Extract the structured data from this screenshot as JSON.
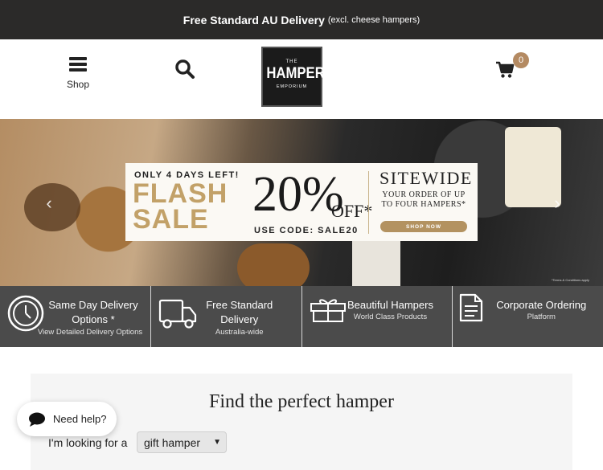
{
  "topbar": {
    "main": "Free Standard AU Delivery",
    "note": "(excl. cheese hampers)"
  },
  "header": {
    "menu_label": "Shop",
    "logo": {
      "line1": "THE",
      "line2": "HAMPER",
      "line3": "EMPORIUM"
    },
    "cart_count": "0",
    "icons": {
      "menu": "hamburger-icon",
      "search": "search-icon",
      "cart": "cart-icon"
    }
  },
  "hero": {
    "days_left": "ONLY 4 DAYS LEFT!",
    "flash": "FLASH",
    "sale": "SALE",
    "percent": "20%",
    "off": "OFF*",
    "code": "USE CODE: SALE20",
    "sitewide": "SITEWIDE",
    "order": "YOUR ORDER OF UP TO FOUR HAMPERS*",
    "shop_now": "SHOP NOW",
    "fine_print": "*Terms & Conditions apply",
    "colors": {
      "gold": "#c2a168",
      "button": "#b39260"
    }
  },
  "features": [
    {
      "title": "Same Day Delivery Options *",
      "sub": "View Detailed Delivery Options",
      "icon": "clock-icon"
    },
    {
      "title": "Free Standard Delivery",
      "sub": "Australia-wide",
      "icon": "truck-icon"
    },
    {
      "title": "Beautiful Hampers",
      "sub": "World Class Products",
      "icon": "gift-box-icon"
    },
    {
      "title": "Corporate Ordering",
      "sub": "Platform",
      "icon": "document-icon"
    }
  ],
  "finder": {
    "heading": "Find the perfect hamper",
    "label": "I'm looking for a",
    "select_value": "gift hamper"
  },
  "help": {
    "label": "Need help?",
    "icon": "chat-bubble-icon"
  }
}
